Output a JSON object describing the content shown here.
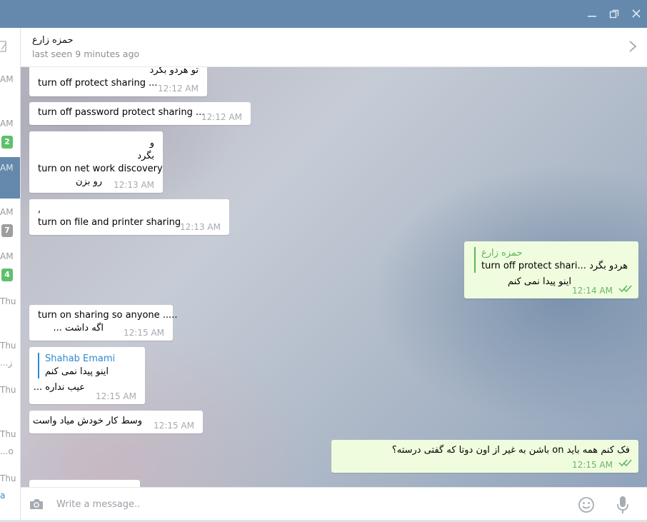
{
  "window": {
    "minimize_icon": "minimize-icon",
    "restore_icon": "restore-icon",
    "close_icon": "close-icon"
  },
  "colors": {
    "titlebar": "#6489ac",
    "incoming_bubble": "#ffffff",
    "outgoing_bubble": "#effdde",
    "reply_accent_green": "#5fb35c",
    "reply_accent_blue": "#2f8acf",
    "badge_green": "#5ec06b",
    "badge_gray": "#9e9e9e"
  },
  "sidebar": {
    "compose_icon": "compose-icon",
    "times": [
      "AM",
      "AM",
      "AM",
      "AM",
      "AM",
      "Thu",
      "Thu",
      "Thu",
      "Thu",
      "Thu"
    ],
    "badges": [
      "2",
      "7",
      "4"
    ],
    "snippets": [
      "...ز",
      "...o",
      "a"
    ]
  },
  "header": {
    "name": "حمزه زارع",
    "status": "last seen 9 minutes ago",
    "chevron_icon": "chevron-right-icon"
  },
  "messages": {
    "m1": {
      "line1": "تو هردو بگرد",
      "line2": "turn off protect sharing ...",
      "time": "12:12 AM"
    },
    "m2": {
      "line1": "turn off password protect sharing ...",
      "time": "12:12 AM"
    },
    "m3": {
      "line1": "و",
      "line2": "بگرد",
      "line3": "turn on net work discovery",
      "line4": "رو بزن",
      "time": "12:13 AM"
    },
    "m4": {
      "line1": ",",
      "line2": "turn on file and printer sharing",
      "time": "12:13 AM"
    },
    "m5": {
      "reply_name": "حمزه زارع",
      "reply_text": "turn off protect shari...  تو هردو بگرد",
      "line1": "اینو پیدا نمی کنم",
      "time": "12:14 AM"
    },
    "m6": {
      "line1": "turn on sharing so anyone .....",
      "line2": "اگه داشت ...",
      "time": "12:15 AM"
    },
    "m7": {
      "reply_name": "Shahab Emami",
      "reply_text": "اینو پیدا نمی کنم",
      "line1": "عیب نداره ...",
      "time": "12:15 AM"
    },
    "m8": {
      "line1": "وسط کار خودش میاد واست",
      "time": "12:15 AM"
    },
    "m9": {
      "line1": "فک کنم همه باید on باشن به غیر از اون دوتا که گفتی درسته؟",
      "time": "12:15 AM"
    }
  },
  "composer": {
    "placeholder": "Write a message..",
    "camera_icon": "camera-icon",
    "emoji_icon": "emoji-icon",
    "mic_icon": "microphone-icon"
  }
}
